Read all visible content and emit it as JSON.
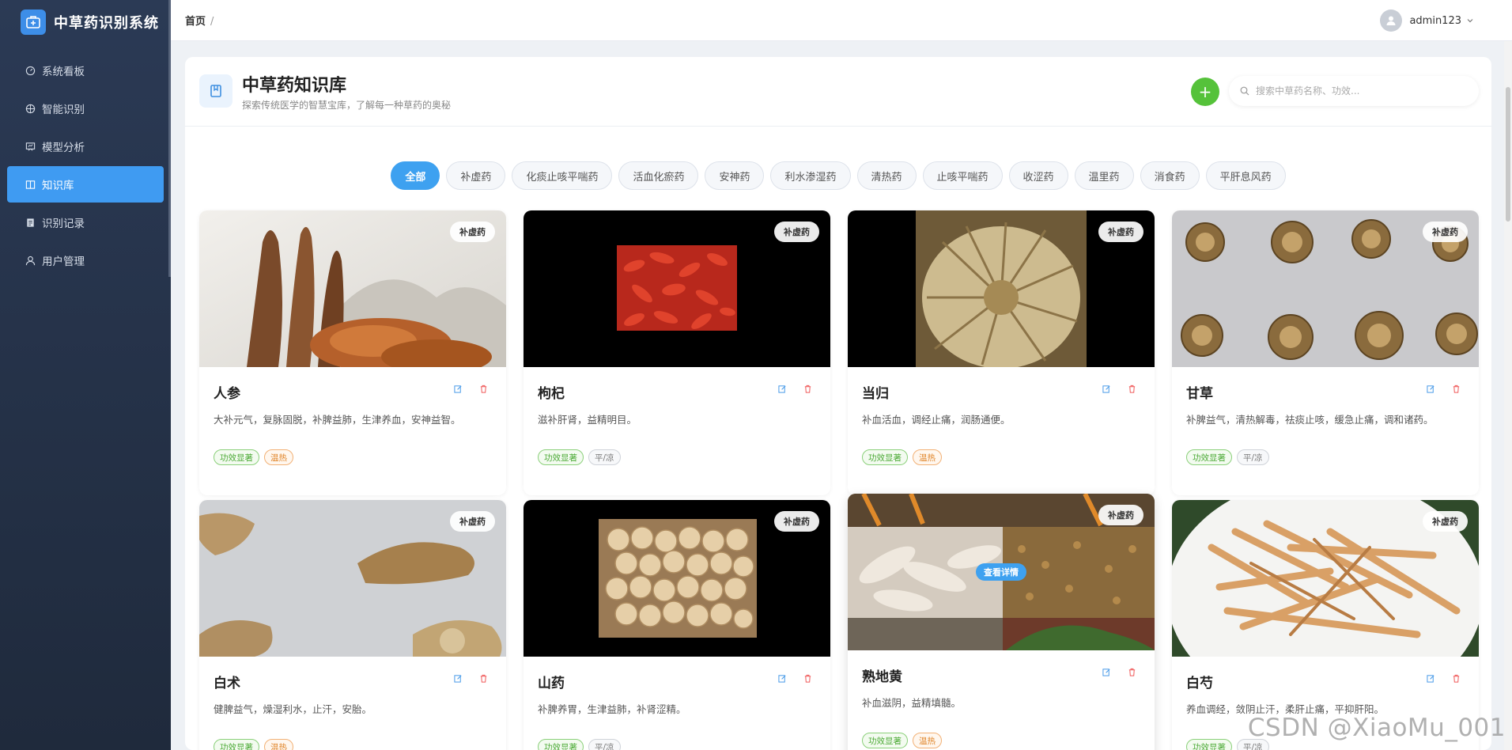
{
  "app": {
    "title": "中草药识别系统"
  },
  "sidebar": {
    "items": [
      {
        "label": "系统看板",
        "icon": "dashboard-icon"
      },
      {
        "label": "智能识别",
        "icon": "scan-icon"
      },
      {
        "label": "模型分析",
        "icon": "chart-icon"
      },
      {
        "label": "知识库",
        "icon": "book-icon",
        "active": true
      },
      {
        "label": "识别记录",
        "icon": "record-icon"
      },
      {
        "label": "用户管理",
        "icon": "user-icon"
      }
    ]
  },
  "topbar": {
    "breadcrumb": "首页",
    "breadcrumb_sep": "/",
    "username": "admin123"
  },
  "page": {
    "title": "中草药知识库",
    "subtitle": "探索传统医学的智慧宝库，了解每一种草药的奥秘",
    "add_label": "+",
    "search_placeholder": "搜索中草药名称、功效..."
  },
  "categories": [
    "全部",
    "补虚药",
    "化痰止咳平喘药",
    "活血化瘀药",
    "安神药",
    "利水渗湿药",
    "清热药",
    "止咳平喘药",
    "收涩药",
    "温里药",
    "消食药",
    "平肝息风药"
  ],
  "active_category": "全部",
  "herbs": [
    {
      "name": "人参",
      "badge": "补虚药",
      "desc": "大补元气，复脉固脱，补脾益肺，生津养血，安神益智。",
      "tags": [
        {
          "text": "功效显著",
          "style": "green"
        },
        {
          "text": "温热",
          "style": "orange"
        }
      ]
    },
    {
      "name": "枸杞",
      "badge": "补虚药",
      "desc": "滋补肝肾，益精明目。",
      "tags": [
        {
          "text": "功效显著",
          "style": "green"
        },
        {
          "text": "平/凉",
          "style": "gray"
        }
      ]
    },
    {
      "name": "当归",
      "badge": "补虚药",
      "desc": "补血活血，调经止痛，润肠通便。",
      "tags": [
        {
          "text": "功效显著",
          "style": "green"
        },
        {
          "text": "温热",
          "style": "orange"
        }
      ]
    },
    {
      "name": "甘草",
      "badge": "补虚药",
      "desc": "补脾益气，清热解毒，祛痰止咳，缓急止痛，调和诸药。",
      "tags": [
        {
          "text": "功效显著",
          "style": "green"
        },
        {
          "text": "平/凉",
          "style": "gray"
        }
      ]
    },
    {
      "name": "白术",
      "badge": "补虚药",
      "desc": "健脾益气，燥湿利水，止汗，安胎。",
      "tags": [
        {
          "text": "功效显著",
          "style": "green"
        },
        {
          "text": "温热",
          "style": "orange"
        }
      ]
    },
    {
      "name": "山药",
      "badge": "补虚药",
      "desc": "补脾养胃，生津益肺，补肾涩精。",
      "tags": [
        {
          "text": "功效显著",
          "style": "green"
        },
        {
          "text": "平/凉",
          "style": "gray"
        }
      ]
    },
    {
      "name": "熟地黄",
      "badge": "补虚药",
      "desc": "补血滋阴，益精填髓。",
      "view_label": "查看详情",
      "tags": [
        {
          "text": "功效显著",
          "style": "green"
        },
        {
          "text": "温热",
          "style": "orange"
        }
      ]
    },
    {
      "name": "白芍",
      "badge": "补虚药",
      "desc": "养血调经，敛阴止汗，柔肝止痛，平抑肝阳。",
      "tags": [
        {
          "text": "功效显著",
          "style": "green"
        },
        {
          "text": "平/凉",
          "style": "gray"
        }
      ]
    }
  ],
  "watermark": "CSDN @XiaoMu_001",
  "colors": {
    "accent": "#3ea1f0",
    "sidebar": "#26334a",
    "add": "#55c23a"
  }
}
